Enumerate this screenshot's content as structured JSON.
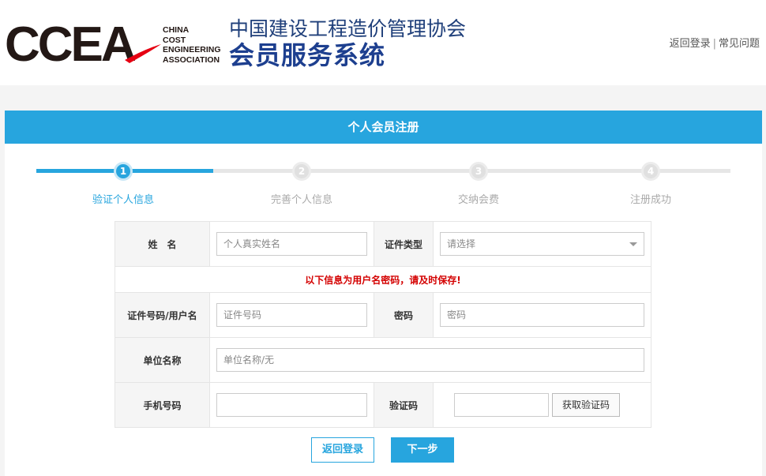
{
  "header": {
    "logo_word": "CCEA",
    "logo_sub": [
      "CHINA",
      "COST",
      "ENGINEERING",
      "ASSOCIATION"
    ],
    "org_name": "中国建设工程造价管理协会",
    "system_name": "会员服务系统",
    "link_login": "返回登录",
    "link_sep": "|",
    "link_faq": "常见问题"
  },
  "panel": {
    "title": "个人会员注册"
  },
  "steps": [
    {
      "num": "1",
      "label": "验证个人信息",
      "active": true
    },
    {
      "num": "2",
      "label": "完善个人信息",
      "active": false
    },
    {
      "num": "3",
      "label": "交纳会费",
      "active": false
    },
    {
      "num": "4",
      "label": "注册成功",
      "active": false
    }
  ],
  "form": {
    "name_label": "姓　名",
    "name_placeholder": "个人真实姓名",
    "id_type_label": "证件类型",
    "id_type_value": "请选择",
    "notice": "以下信息为用户名密码，请及时保存!",
    "id_number_label": "证件号码/用户名",
    "id_number_placeholder": "证件号码",
    "password_label": "密码",
    "password_placeholder": "密码",
    "company_label": "单位名称",
    "company_placeholder": "单位名称/无",
    "phone_label": "手机号码",
    "phone_placeholder": "",
    "code_label": "验证码",
    "code_placeholder": "",
    "get_code_button": "获取验证码"
  },
  "buttons": {
    "back": "返回登录",
    "next": "下一步"
  },
  "colors": {
    "accent": "#27a5de",
    "brand_navy": "#1d3f8f",
    "notice_red": "#d40000"
  }
}
